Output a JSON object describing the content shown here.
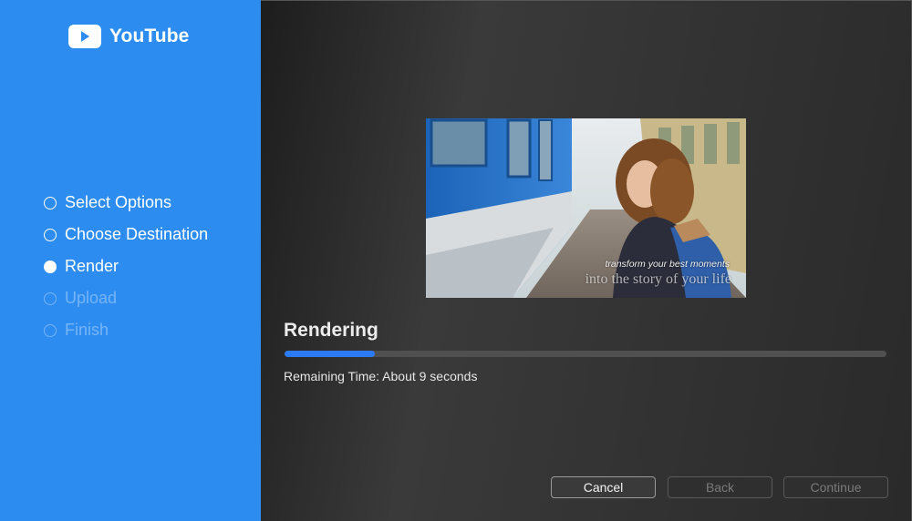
{
  "sidebar": {
    "brand": "YouTube",
    "steps": [
      {
        "label": "Select Options",
        "state": "done"
      },
      {
        "label": "Choose Destination",
        "state": "done"
      },
      {
        "label": "Render",
        "state": "current"
      },
      {
        "label": "Upload",
        "state": "disabled"
      },
      {
        "label": "Finish",
        "state": "disabled"
      }
    ]
  },
  "main": {
    "preview": {
      "caption_line1": "transform your best moments",
      "caption_line2": "into the story of your life"
    },
    "status_title": "Rendering",
    "progress": 0.15,
    "remaining_time": "Remaining Time: About 9 seconds"
  },
  "buttons": {
    "cancel": "Cancel",
    "back": "Back",
    "continue": "Continue"
  },
  "colors": {
    "sidebar": "#2d8cf0",
    "accent": "#2a7bf5"
  }
}
